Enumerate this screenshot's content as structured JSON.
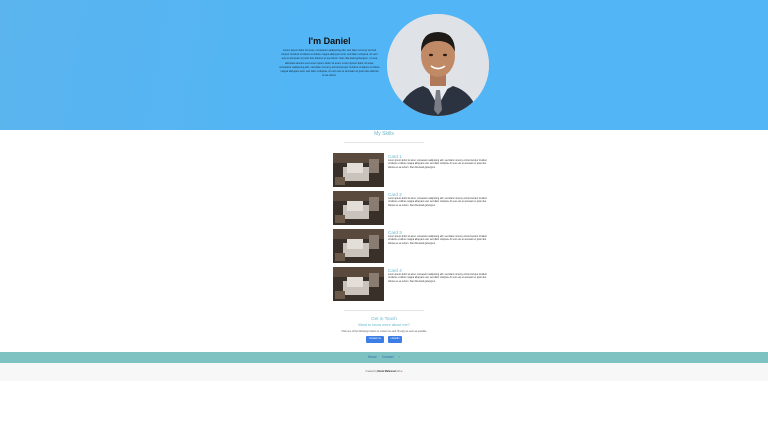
{
  "hero": {
    "title": "I'm Daniel",
    "bio": "Lorem ipsum dolor sit amet, consetetur sadipscing elitr, sed diam nonumy eirmod tempor invidunt ut labore et dolore magna aliquyam erat, sed diam voluptua. At vero eos et accusam et justo duo dolores et ea rebum. Stet clita kasd gubergren, no sea takimata sanctus est Lorem ipsum dolor sit amet. Lorem ipsum dolor sit amet, consetetur sadipscing elitr, sed diam nonumy eirmod tempor invidunt ut labore et dolore magna aliquyam erat, sed diam voluptua. At vero eos et accusam et justo duo dolores et ea rebum."
  },
  "skills": {
    "title": "My Skills",
    "cards": [
      {
        "title": "Card 1",
        "text": "Lorem ipsum dolor sit amet, consetetur sadipscing elitr, sed diam nonumy eirmod tempor invidunt ut labore et dolore magna aliquyam erat, sed diam voluptua. At vero eos et accusam et justo duo dolores et ea rebum. Stet clita kasd gubergren."
      },
      {
        "title": "Card 2",
        "text": "Lorem ipsum dolor sit amet, consetetur sadipscing elitr, sed diam nonumy eirmod tempor invidunt ut labore et dolore magna aliquyam erat, sed diam voluptua. At vero eos et accusam et justo duo dolores et ea rebum. Stet clita kasd gubergren."
      },
      {
        "title": "Card 3",
        "text": "Lorem ipsum dolor sit amet, consetetur sadipscing elitr, sed diam nonumy eirmod tempor invidunt ut labore et dolore magna aliquyam erat, sed diam voluptua. At vero eos et accusam et justo duo dolores et ea rebum. Stet clita kasd gubergren."
      },
      {
        "title": "Card 4",
        "text": "Lorem ipsum dolor sit amet, consetetur sadipscing elitr, sed diam nonumy eirmod tempor invidunt ut labore et dolore magna aliquyam erat, sed diam voluptua. At vero eos et accusam et justo duo dolores et ea rebum. Stet clita kasd gubergren."
      }
    ]
  },
  "contact": {
    "title": "Get in Touch",
    "subtitle": "Want to know more about me?",
    "description": "Click one of the following buttons to contact me and I'll reply as soon as possible",
    "button_contact": "Contact me",
    "button_linkedin": "LinkedIn"
  },
  "footer": {
    "links": [
      "Home",
      "Contact",
      "↑"
    ],
    "credit_prefix": "Created by",
    "credit_name": "Daniel Mahmoud",
    "credit_suffix": "with",
    "heart": "♥"
  },
  "colors": {
    "hero_bg": "#52b5f5",
    "accent_teal": "#6bb7cc",
    "button_blue": "#3d7ee6",
    "footer_bar": "#7fc2c2"
  }
}
